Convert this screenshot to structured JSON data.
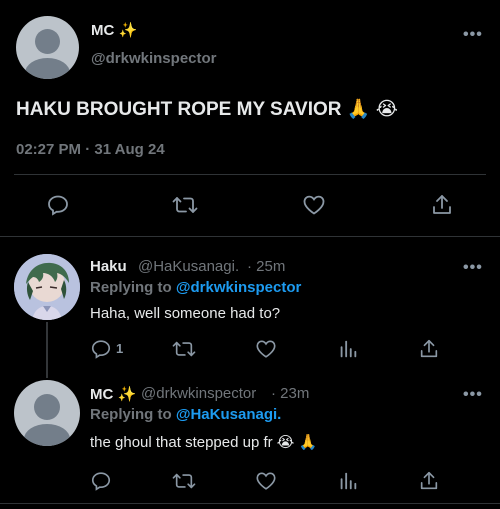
{
  "main_tweet": {
    "display_name": "MC ✨",
    "handle": "@drkwkinspector",
    "text": "HAKU BROUGHT ROPE MY SAVIOR 🙏 😭",
    "timestamp": "02:27 PM · 31 Aug 24"
  },
  "replies": [
    {
      "display_name": "Haku",
      "handle": "@HaKusanagi.",
      "time": "· 25m",
      "replying_label": "Replying to",
      "replying_to": "@drkwkinspector",
      "text": "Haha, well someone had to?",
      "reply_count": "1"
    },
    {
      "display_name": "MC ✨",
      "handle": "@drkwkinspector",
      "time": "· 23m",
      "replying_label": "Replying to",
      "replying_to": "@HaKusanagi.",
      "text": "the ghoul that stepped up fr 😭 🙏"
    }
  ],
  "more_menu": "•••",
  "colors": {
    "background": "#000000",
    "text": "#e7e9ea",
    "muted": "#71767b",
    "link": "#1d9bf0",
    "divider": "#2f3336"
  }
}
